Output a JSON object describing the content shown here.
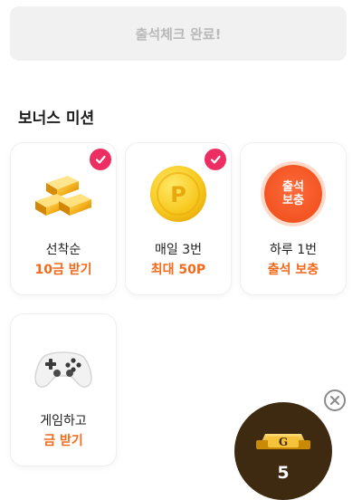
{
  "checkin": {
    "label": "출석체크 완료!"
  },
  "section": {
    "title": "보너스 미션"
  },
  "missions": [
    {
      "title": "선착순",
      "reward": "10금 받기",
      "completed": true,
      "icon": "gold-bars-icon"
    },
    {
      "title": "매일 3번",
      "reward": "최대 50P",
      "completed": true,
      "icon": "point-coin-icon",
      "coin_letter": "P"
    },
    {
      "title": "하루 1번",
      "reward": "출석 보충",
      "completed": false,
      "icon": "attendance-refill-icon",
      "badge_line1": "출석",
      "badge_line2": "보충"
    },
    {
      "title": "게임하고",
      "reward": "금 받기",
      "completed": false,
      "icon": "game-controller-icon"
    }
  ],
  "floating": {
    "icon": "gold-bar-g-icon",
    "letter": "G",
    "count": "5"
  },
  "colors": {
    "accent": "#f26a1b",
    "check": "#ec2e62",
    "floating_bg": "#3d2a10"
  }
}
